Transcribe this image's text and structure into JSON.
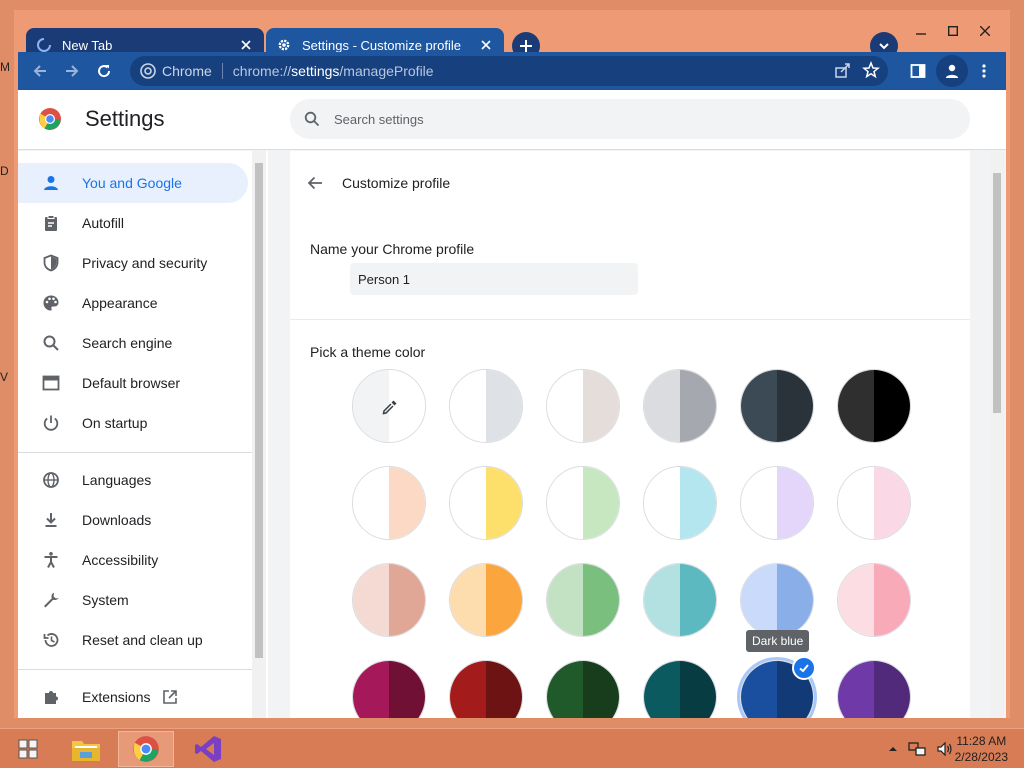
{
  "desktop_edge": [
    "M",
    "D",
    "V"
  ],
  "tabs": [
    {
      "title": "New Tab",
      "icon": "loading-spinner-icon"
    },
    {
      "title": "Settings - Customize profile",
      "icon": "gear-icon"
    }
  ],
  "omnibox": {
    "chip": "Chrome",
    "url_scheme": "chrome://",
    "url_host": "settings",
    "url_path": "/manageProfile"
  },
  "header": {
    "title": "Settings",
    "search_placeholder": "Search settings"
  },
  "sidebar": {
    "items": [
      {
        "label": "You and Google",
        "icon": "person-icon",
        "selected": true
      },
      {
        "label": "Autofill",
        "icon": "clipboard-icon"
      },
      {
        "label": "Privacy and security",
        "icon": "shield-icon"
      },
      {
        "label": "Appearance",
        "icon": "palette-icon"
      },
      {
        "label": "Search engine",
        "icon": "search-icon"
      },
      {
        "label": "Default browser",
        "icon": "browser-window-icon"
      },
      {
        "label": "On startup",
        "icon": "power-icon"
      },
      {
        "label": "Languages",
        "icon": "globe-icon"
      },
      {
        "label": "Downloads",
        "icon": "download-icon"
      },
      {
        "label": "Accessibility",
        "icon": "accessibility-icon"
      },
      {
        "label": "System",
        "icon": "wrench-icon"
      },
      {
        "label": "Reset and clean up",
        "icon": "history-icon"
      },
      {
        "label": "Extensions",
        "icon": "puzzle-icon"
      }
    ]
  },
  "main": {
    "sub_title": "Customize profile",
    "name_label": "Name your Chrome profile",
    "name_value": "Person 1",
    "theme_label": "Pick a theme color",
    "tooltip": "Dark blue",
    "swatches": [
      [
        "#f1f3f4",
        "#ffffff"
      ],
      [
        "#ffffff",
        "#dee1e6"
      ],
      [
        "#ffffff",
        "#e5ddd9"
      ],
      [
        "#dadce0",
        "#a6a8b0"
      ],
      [
        "#3c4a55",
        "#2a333a"
      ],
      [
        "#2f2f2f",
        "#000000"
      ],
      [
        "#ffffff",
        "#fcd9c4"
      ],
      [
        "#ffffff",
        "#fde06c"
      ],
      [
        "#ffffff",
        "#c7e7c0"
      ],
      [
        "#ffffff",
        "#b4e6f0"
      ],
      [
        "#ffffff",
        "#e4d5fb"
      ],
      [
        "#ffffff",
        "#fbd8e6"
      ],
      [
        "#f5dad3",
        "#e0a696"
      ],
      [
        "#fddcae",
        "#fba53e"
      ],
      [
        "#c3e1c3",
        "#7bbf7f"
      ],
      [
        "#b3e1e1",
        "#5bb9bf"
      ],
      [
        "#c9dafa",
        "#8aaee8"
      ],
      [
        "#fcdde4",
        "#f8aab9"
      ],
      [
        "#a5195a",
        "#701034"
      ],
      [
        "#a31b1b",
        "#6d1313"
      ],
      [
        "#215a2a",
        "#173d1c"
      ],
      [
        "#0a5a60",
        "#073d42"
      ],
      [
        "#1a4f9f",
        "#123a77"
      ],
      [
        "#6f3aa8",
        "#512a7c"
      ]
    ],
    "selected_index": 22
  },
  "taskbar": {
    "time": "11:28 AM",
    "date": "2/28/2023"
  }
}
